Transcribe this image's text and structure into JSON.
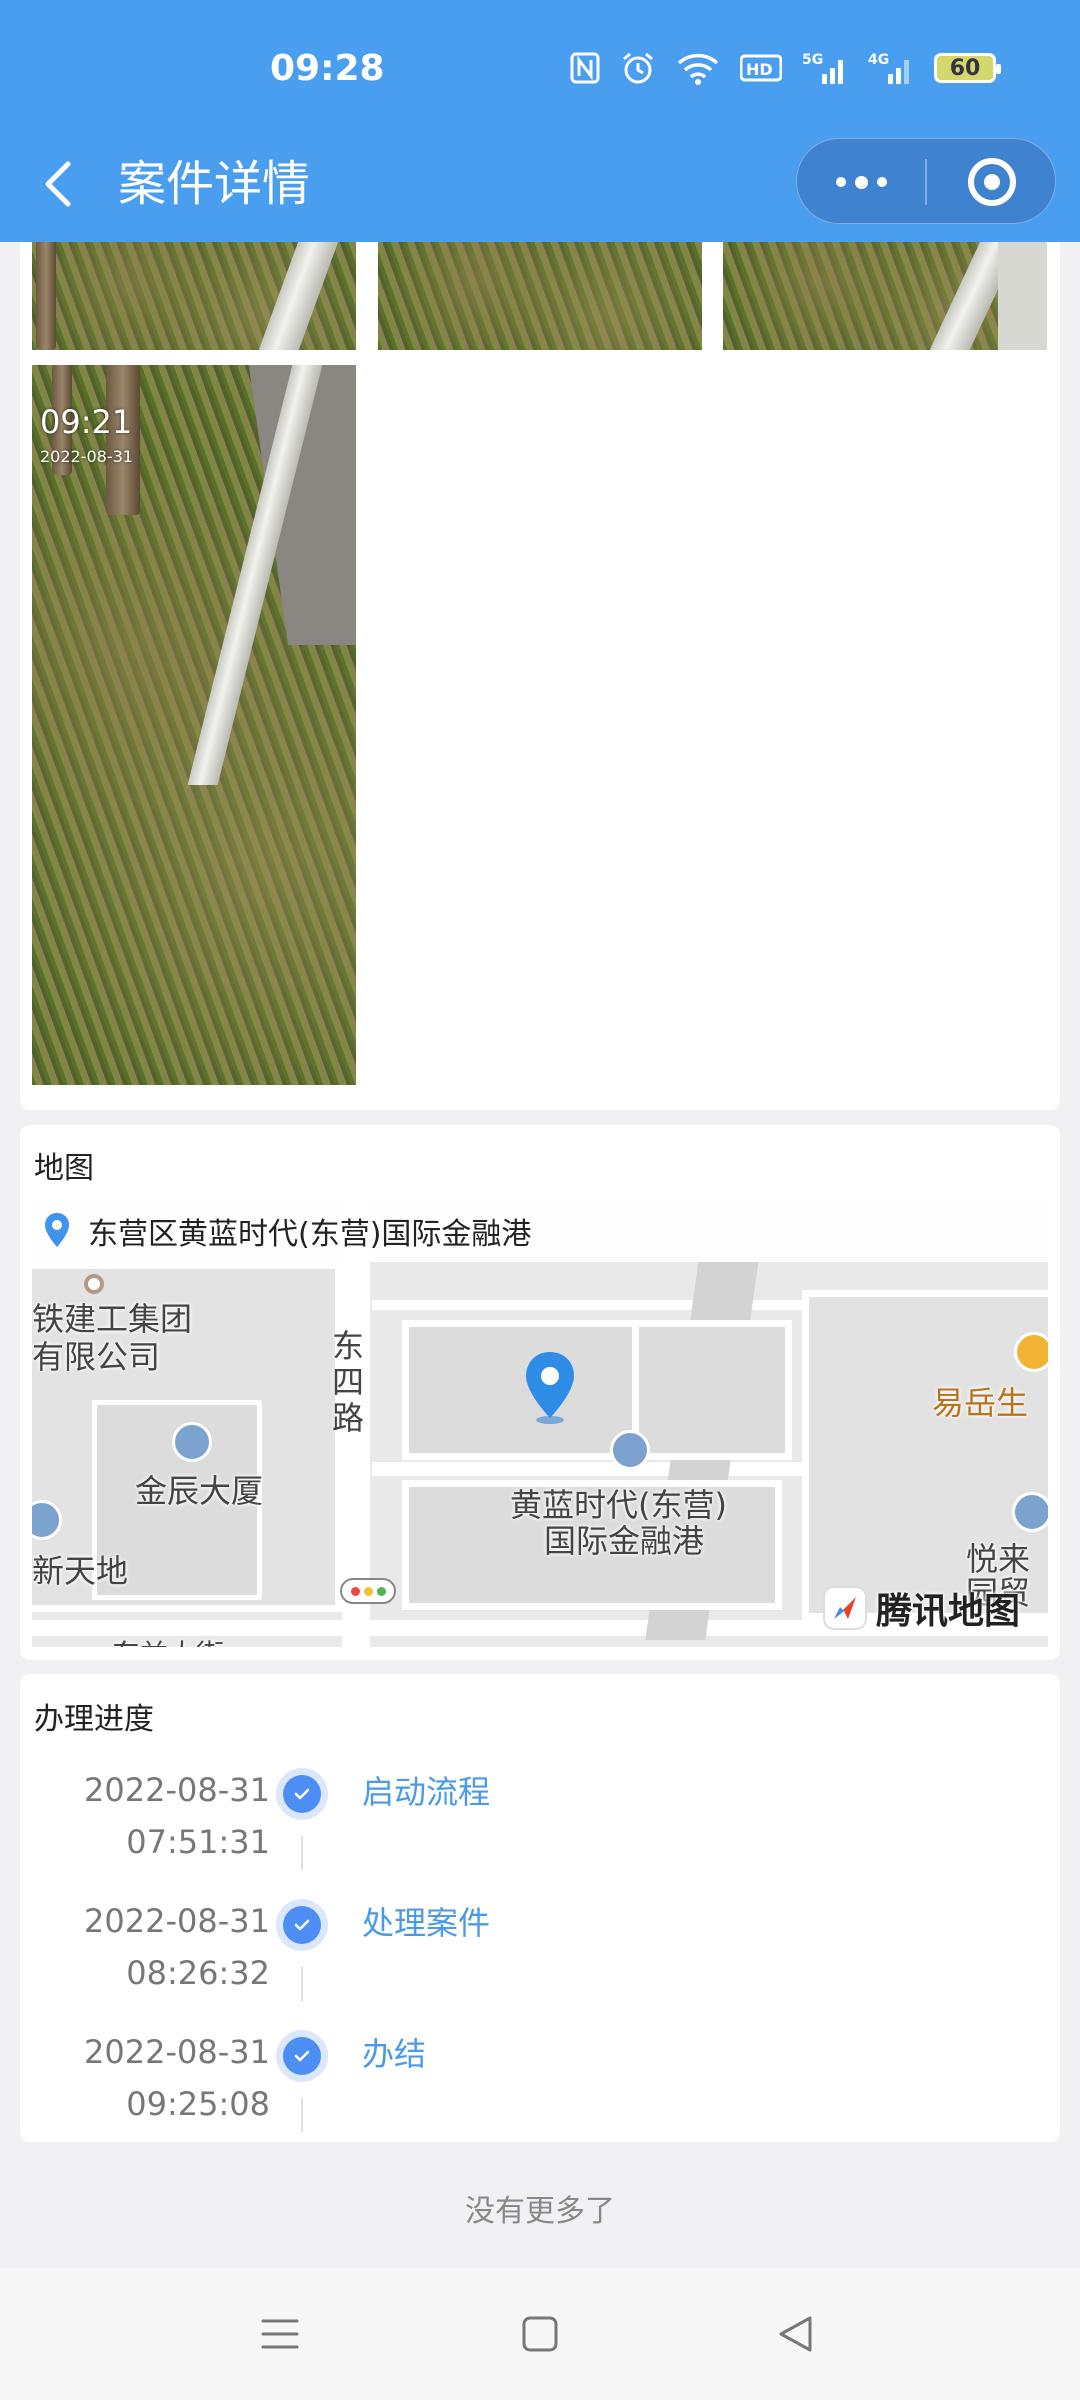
{
  "status_bar": {
    "time": "09:28",
    "icons": [
      "nfc-icon",
      "alarm-icon",
      "wifi-icon",
      "hd-icon",
      "signal-5g-icon",
      "signal-4g-icon"
    ],
    "battery": "60"
  },
  "header": {
    "title": "案件详情",
    "capsule": [
      "more-icon",
      "close-miniprogram-icon"
    ]
  },
  "photos": {
    "stamp_time": "09:21",
    "stamp_date": "2022-08-31"
  },
  "map_section": {
    "title": "地图",
    "address": "东营区黄蓝时代(东营)国际金融港",
    "labels": {
      "company_line1": "铁建工集团",
      "company_line2": "有限公司",
      "road": "东四路",
      "jinchen": "金辰大厦",
      "xintiandi": "新天地",
      "huanglan_line1": "黄蓝时代(东营)",
      "huanglan_line2": "国际金融港",
      "yiyue": "易岳生",
      "yuelai_line1": "悦来",
      "yuelai_line2": "园贸",
      "bottom_street": "东益大街"
    },
    "logo": "腾讯地图"
  },
  "progress": {
    "title": "办理进度",
    "steps": [
      {
        "date": "2022-08-31",
        "time": "07:51:31",
        "label": "启动流程"
      },
      {
        "date": "2022-08-31",
        "time": "08:26:32",
        "label": "处理案件"
      },
      {
        "date": "2022-08-31",
        "time": "09:25:08",
        "label": "办结"
      }
    ]
  },
  "footer": {
    "no_more": "没有更多了"
  },
  "colors": {
    "header": "#4a9ef0",
    "accent": "#4a9ae6",
    "step_dot": "#4d8ef5",
    "background": "#f1f1f3"
  }
}
